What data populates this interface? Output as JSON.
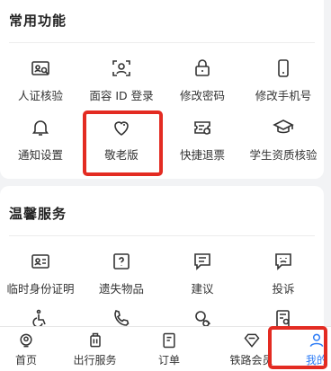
{
  "common": {
    "title": "常用功能",
    "items": [
      {
        "label": "人证核验",
        "icon": "id-verify-icon"
      },
      {
        "label": "面容 ID 登录",
        "icon": "face-id-icon"
      },
      {
        "label": "修改密码",
        "icon": "lock-icon"
      },
      {
        "label": "修改手机号",
        "icon": "phone-icon"
      },
      {
        "label": "通知设置",
        "icon": "bell-icon"
      },
      {
        "label": "敬老版",
        "icon": "heart-icon"
      },
      {
        "label": "快捷退票",
        "icon": "ticket-refund-icon"
      },
      {
        "label": "学生资质核验",
        "icon": "graduation-cap-icon"
      }
    ]
  },
  "warm": {
    "title": "温馨服务",
    "items": [
      {
        "label": "临时身份证明",
        "icon": "id-card-icon"
      },
      {
        "label": "遗失物品",
        "icon": "question-box-icon"
      },
      {
        "label": "建议",
        "icon": "suggestion-icon"
      },
      {
        "label": "投诉",
        "icon": "complaint-icon"
      }
    ]
  },
  "tabbar": {
    "items": [
      {
        "label": "首页",
        "icon": "home-icon"
      },
      {
        "label": "出行服务",
        "icon": "luggage-icon"
      },
      {
        "label": "订单",
        "icon": "order-icon"
      },
      {
        "label": "铁路会员",
        "icon": "diamond-icon"
      },
      {
        "label": "我的",
        "icon": "user-icon"
      }
    ],
    "active_color": "#2d7cf6"
  },
  "highlight_color": "#e32b22"
}
